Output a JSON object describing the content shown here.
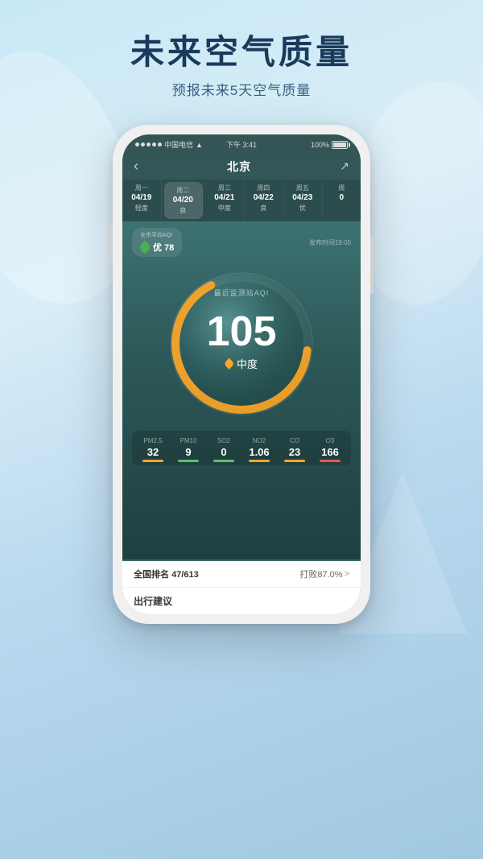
{
  "background": {
    "gradient_start": "#c8e8f5",
    "gradient_end": "#a0c8e0"
  },
  "header": {
    "title": "未来空气质量",
    "subtitle": "预报未来5天空气质量"
  },
  "phone": {
    "status_bar": {
      "carrier": "中国电信",
      "wifi": true,
      "time": "下午 3:41",
      "battery": "100%"
    },
    "nav": {
      "back_label": "‹",
      "title": "北京",
      "share_icon": "↗"
    },
    "days": [
      {
        "week": "周一",
        "date": "04/19",
        "quality": "轻度",
        "active": false
      },
      {
        "week": "周二",
        "date": "04/20",
        "quality": "良",
        "active": true
      },
      {
        "week": "周三",
        "date": "04/21",
        "quality": "中度",
        "active": false
      },
      {
        "week": "周四",
        "date": "04/22",
        "quality": "良",
        "active": false
      },
      {
        "week": "周五",
        "date": "04/23",
        "quality": "优",
        "active": false
      },
      {
        "week": "周",
        "date": "0",
        "quality": "",
        "active": false
      }
    ],
    "aqi_city_label": "全市平均AQI",
    "aqi_city_value": "优 78",
    "publish_time": "发布时间19:00",
    "gauge": {
      "label": "最近监测站AQI",
      "value": "105",
      "quality": "中度"
    },
    "pollutants": [
      {
        "name": "PM2.5",
        "value": "32",
        "color": "#FFA726"
      },
      {
        "name": "PM10",
        "value": "9",
        "color": "#66BB6A"
      },
      {
        "name": "SO2",
        "value": "0",
        "color": "#66BB6A"
      },
      {
        "name": "NO2",
        "value": "1.06",
        "color": "#FFA726"
      },
      {
        "name": "CO",
        "value": "23",
        "color": "#FFA726"
      },
      {
        "name": "O3",
        "value": "166",
        "color": "#EF5350"
      }
    ],
    "ranking": {
      "label": "全国排名",
      "value": "47/613",
      "defeat_label": "打败87.0%",
      "arrow": ">"
    },
    "travel": {
      "title": "出行建议"
    }
  }
}
